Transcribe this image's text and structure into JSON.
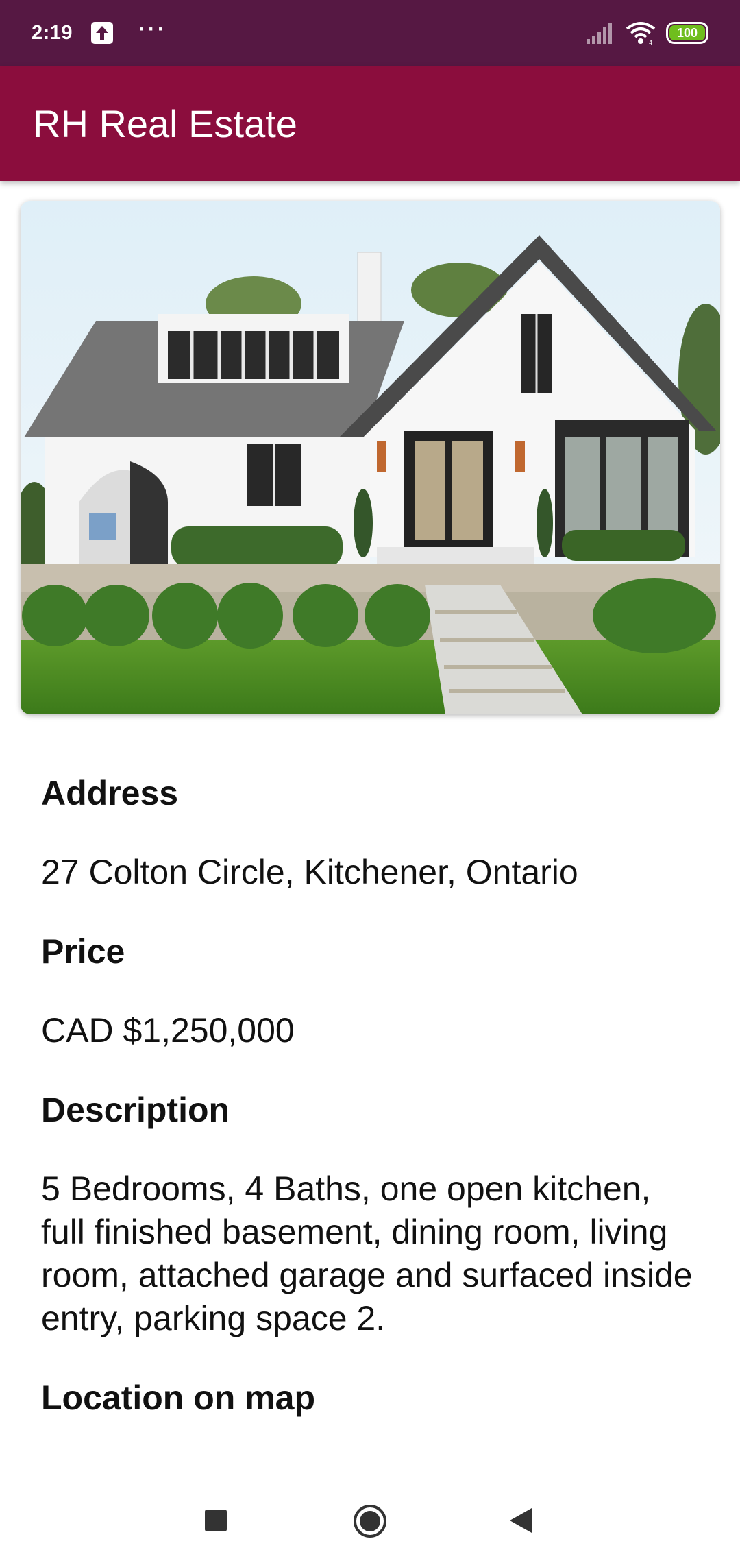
{
  "status_bar": {
    "time": "2:19",
    "battery": "100",
    "icons": [
      "upload-icon",
      "more-dots-icon",
      "signal-icon",
      "wifi-icon",
      "battery-icon"
    ],
    "dots": "···"
  },
  "app_bar": {
    "title": "RH Real Estate"
  },
  "listing": {
    "photo": {
      "description_icon": "house-photo"
    },
    "address_label": "Address",
    "address": "27 Colton Circle, Kitchener, Ontario",
    "price_label": "Price",
    "price": "CAD $1,250,000",
    "description_label": "Description",
    "description": "5 Bedrooms, 4 Baths, one open kitchen, full finished basement, dining room, living room, attached garage and surfaced inside entry, parking space 2.",
    "map_label": "Location on map"
  },
  "nav_bar": {
    "buttons": [
      "recents-button",
      "home-button",
      "back-button"
    ]
  },
  "colors": {
    "status_bar": "#561843",
    "app_bar": "#8b0d3d",
    "battery": "#6fbe1e"
  }
}
